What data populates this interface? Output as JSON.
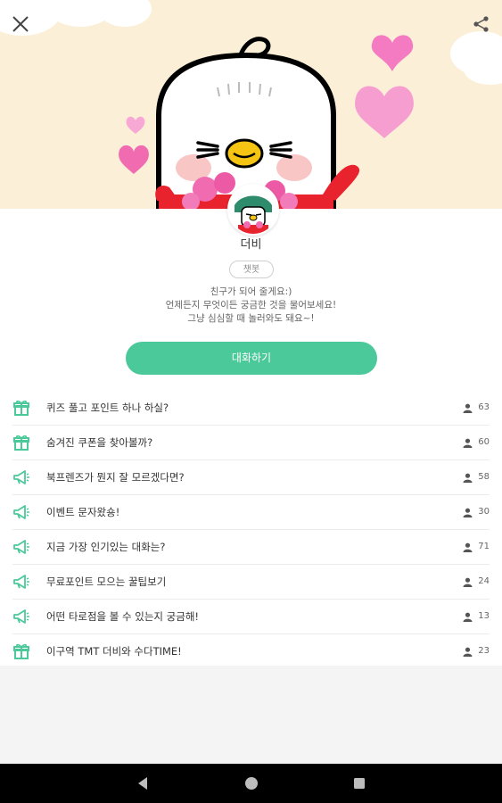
{
  "app": {
    "name": "더비",
    "badge": "챗봇",
    "intro_lines": [
      "친구가 되어 줄게요:)",
      "언제든지 무엇이든 궁금한 것을 물어보세요!",
      "그냥 심심할 때 놀러와도 돼요~!"
    ],
    "chat_button": "대화하기"
  },
  "colors": {
    "accent": "#4cc99b",
    "banner_bg": "#fbefd8",
    "heart": "#f06bb0"
  },
  "topics": [
    {
      "icon": "gift-icon",
      "label": "퀴즈 풀고 포인트 하나 하실?",
      "count": "63"
    },
    {
      "icon": "gift-icon",
      "label": "숨겨진 쿠폰을 찾아볼까?",
      "count": "60"
    },
    {
      "icon": "megaphone-icon",
      "label": "북프렌즈가 뭔지 잘 모르겠다면?",
      "count": "58"
    },
    {
      "icon": "megaphone-icon",
      "label": "이벤트 문자왔숑!",
      "count": "30"
    },
    {
      "icon": "megaphone-icon",
      "label": "지금 가장 인기있는 대화는?",
      "count": "71"
    },
    {
      "icon": "megaphone-icon",
      "label": "무료포인트 모으는 꿀팁보기",
      "count": "24"
    },
    {
      "icon": "megaphone-icon",
      "label": "어떤 타로점을 볼 수 있는지 궁금해!",
      "count": "13"
    },
    {
      "icon": "gift-icon",
      "label": "이구역 TMT 더비와 수다TIME!",
      "count": "23"
    }
  ]
}
